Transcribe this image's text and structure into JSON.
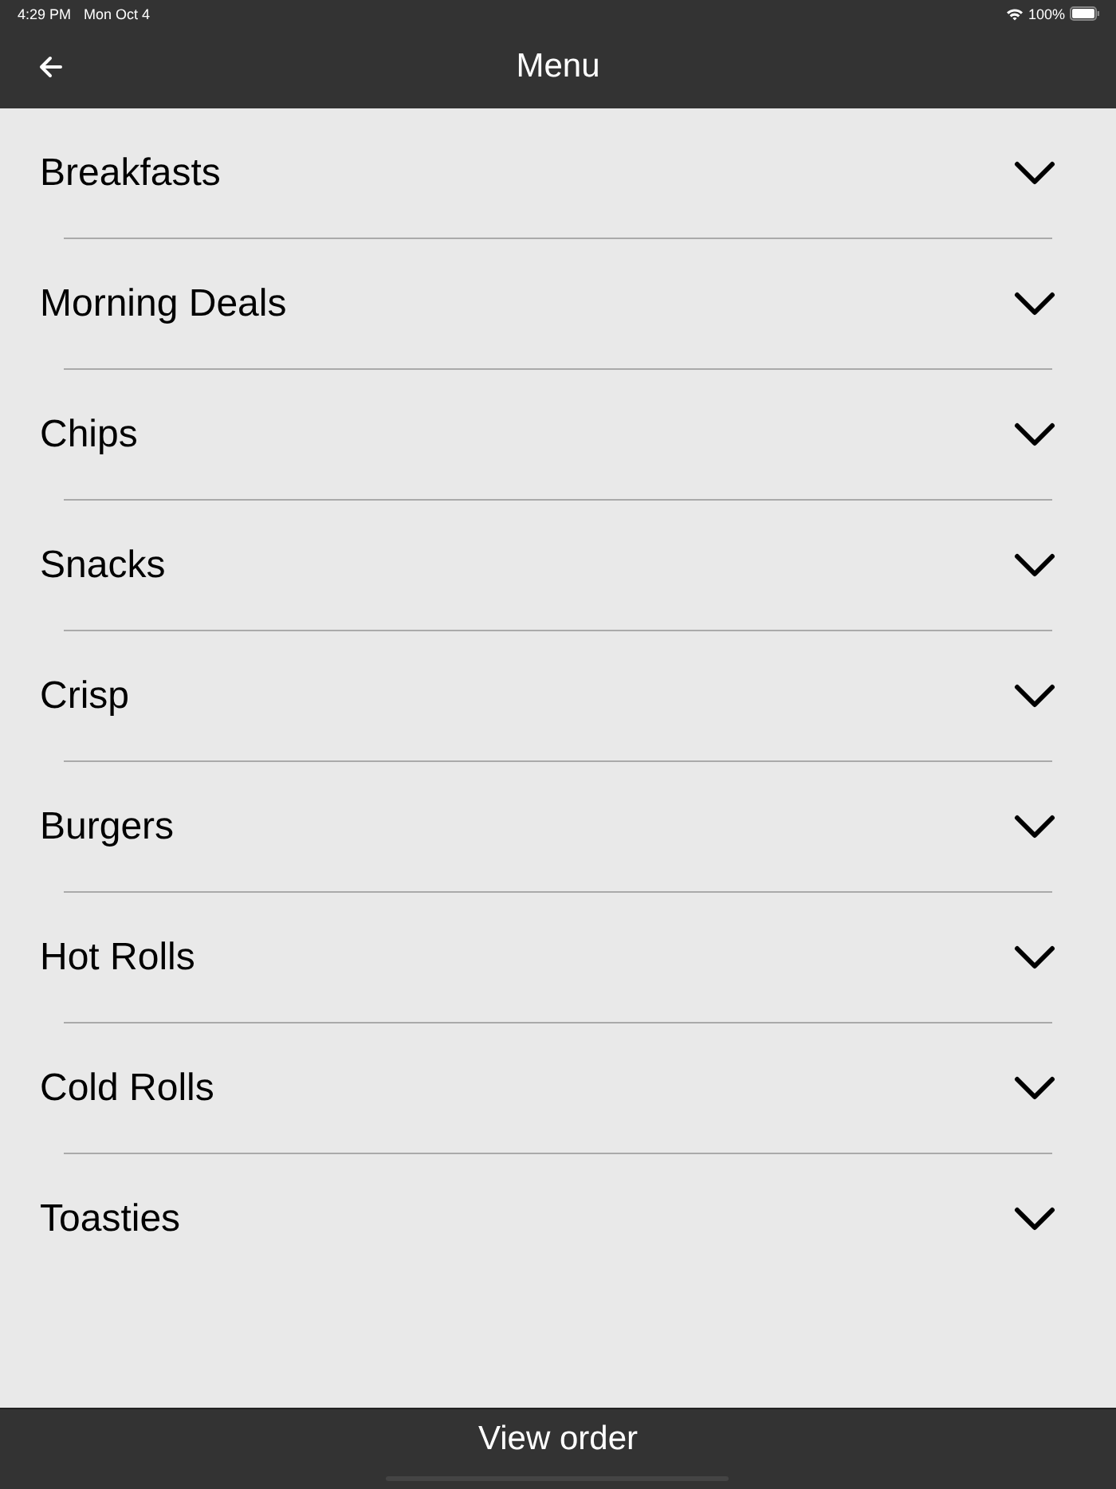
{
  "status_bar": {
    "time": "4:29 PM",
    "date": "Mon Oct 4",
    "battery": "100%"
  },
  "header": {
    "title": "Menu"
  },
  "categories": [
    {
      "label": "Breakfasts",
      "expanded": false
    },
    {
      "label": "Morning Deals",
      "expanded": false
    },
    {
      "label": "Chips",
      "expanded": false
    },
    {
      "label": "Snacks",
      "expanded": false
    },
    {
      "label": "Crisp",
      "expanded": false
    },
    {
      "label": "Burgers",
      "expanded": false
    },
    {
      "label": "Hot Rolls",
      "expanded": false
    },
    {
      "label": "Cold Rolls",
      "expanded": false
    },
    {
      "label": "Toasties",
      "expanded": false
    }
  ],
  "footer": {
    "button": "View order"
  }
}
